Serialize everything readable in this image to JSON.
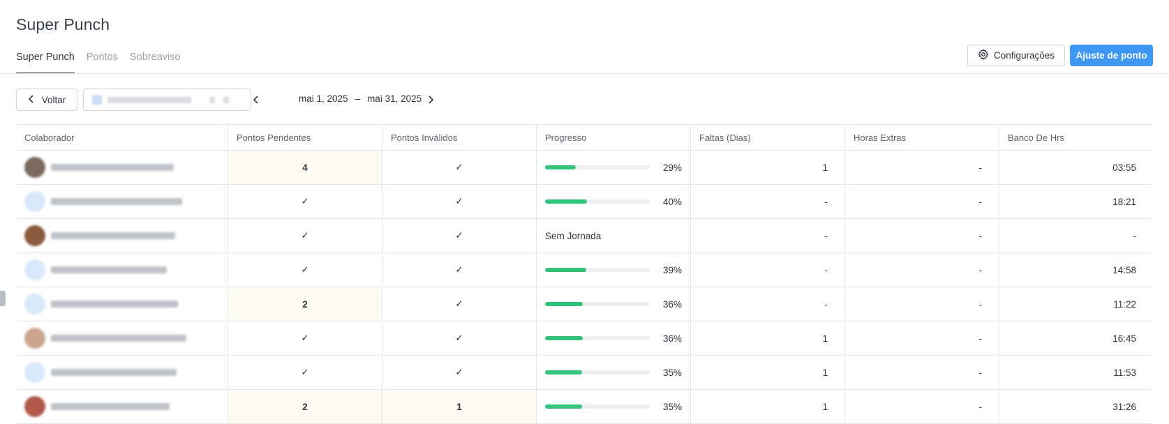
{
  "app": {
    "title": "Super Punch"
  },
  "tabs": [
    {
      "label": "Super Punch",
      "active": true
    },
    {
      "label": "Pontos",
      "active": false
    },
    {
      "label": "Sobreaviso",
      "active": false
    }
  ],
  "toolbar": {
    "config_label": "Configurações",
    "adjust_label": "Ajuste de ponto",
    "back_label": "Voltar",
    "date_start": "mai 1, 2025",
    "date_separator": "–",
    "date_end": "mai 31, 2025"
  },
  "colors": {
    "accent": "#3d97f3",
    "progress": "#33c47a",
    "highlight": "#fdfbf1"
  },
  "table": {
    "headers": [
      "Colaborador",
      "Pontos Pendentes",
      "Pontos Inválidos",
      "Progresso",
      "Faltas (Dias)",
      "Horas Extras",
      "Banco De Hrs"
    ],
    "rows": [
      {
        "pendentes": "4",
        "invalidos": "✓",
        "progress": 0.29,
        "progress_label": "29%",
        "faltas": "1",
        "extras": "-",
        "banco": "03:55"
      },
      {
        "pendentes": "✓",
        "invalidos": "✓",
        "progress": 0.4,
        "progress_label": "40%",
        "faltas": "-",
        "extras": "-",
        "banco": "18:21"
      },
      {
        "pendentes": "✓",
        "invalidos": "✓",
        "progress": null,
        "progress_label": "Sem Jornada",
        "faltas": "-",
        "extras": "-",
        "banco": "-"
      },
      {
        "pendentes": "✓",
        "invalidos": "✓",
        "progress": 0.39,
        "progress_label": "39%",
        "faltas": "-",
        "extras": "-",
        "banco": "14:58"
      },
      {
        "pendentes": "2",
        "invalidos": "✓",
        "progress": 0.36,
        "progress_label": "36%",
        "faltas": "-",
        "extras": "-",
        "banco": "11:22"
      },
      {
        "pendentes": "✓",
        "invalidos": "✓",
        "progress": 0.36,
        "progress_label": "36%",
        "faltas": "1",
        "extras": "-",
        "banco": "16:45"
      },
      {
        "pendentes": "✓",
        "invalidos": "✓",
        "progress": 0.35,
        "progress_label": "35%",
        "faltas": "1",
        "extras": "-",
        "banco": "11:53"
      },
      {
        "pendentes": "2",
        "invalidos": "1",
        "progress": 0.35,
        "progress_label": "35%",
        "faltas": "1",
        "extras": "-",
        "banco": "31:26"
      }
    ]
  }
}
